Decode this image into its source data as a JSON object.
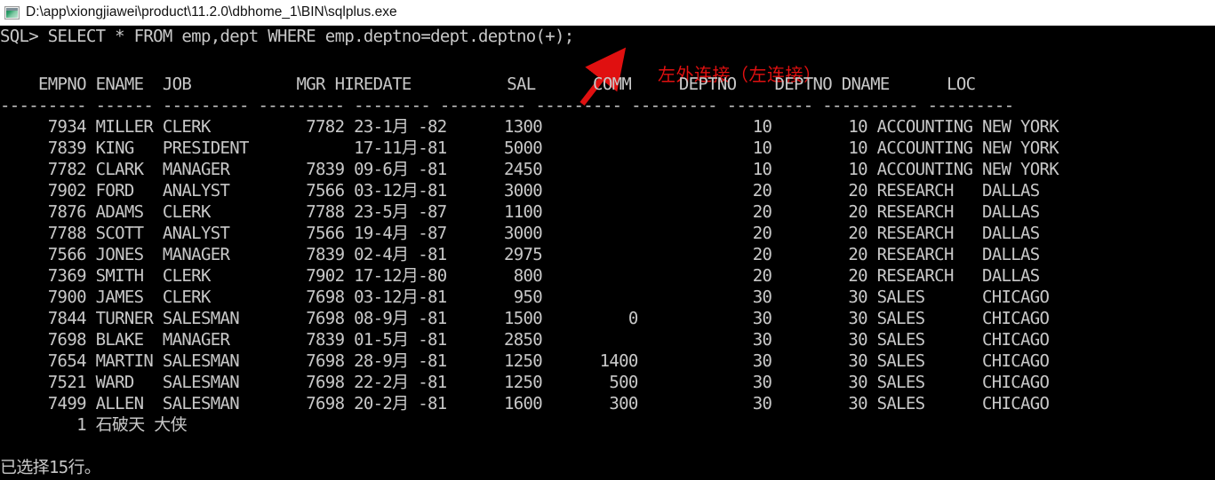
{
  "window": {
    "title": "D:\\app\\xiongjiawei\\product\\11.2.0\\dbhome_1\\BIN\\sqlplus.exe",
    "icon": "console-window-icon"
  },
  "terminal": {
    "prompt": "SQL>",
    "command": "SELECT * FROM emp,dept WHERE emp.deptno=dept.deptno(+);",
    "prompt_line": "SQL> SELECT * FROM emp,dept WHERE emp.deptno=dept.deptno(+);",
    "annotation": {
      "text": "左外连接（左连接）",
      "color": "#e01010",
      "arrow": "red-arrow-icon"
    },
    "header_line": "    EMPNO ENAME  JOB           MGR HIREDATE          SAL      COMM     DEPTNO    DEPTNO DNAME      LOC",
    "separator_line": "--------- ------ --------- --------- -------- --------- --------- --------- --------- ---------- ---------",
    "columns": [
      "EMPNO",
      "ENAME",
      "JOB",
      "MGR",
      "HIREDATE",
      "SAL",
      "COMM",
      "DEPTNO",
      "DEPTNO",
      "DNAME",
      "LOC"
    ],
    "rows": [
      {
        "empno": "7934",
        "ename": "MILLER",
        "job": "CLERK",
        "mgr": "7782",
        "hiredate": "23-1月 -82",
        "sal": "1300",
        "comm": "",
        "deptno_e": "10",
        "deptno_d": "10",
        "dname": "ACCOUNTING",
        "loc": "NEW YORK"
      },
      {
        "empno": "7839",
        "ename": "KING",
        "job": "PRESIDENT",
        "mgr": "",
        "hiredate": "17-11月-81",
        "sal": "5000",
        "comm": "",
        "deptno_e": "10",
        "deptno_d": "10",
        "dname": "ACCOUNTING",
        "loc": "NEW YORK"
      },
      {
        "empno": "7782",
        "ename": "CLARK",
        "job": "MANAGER",
        "mgr": "7839",
        "hiredate": "09-6月 -81",
        "sal": "2450",
        "comm": "",
        "deptno_e": "10",
        "deptno_d": "10",
        "dname": "ACCOUNTING",
        "loc": "NEW YORK"
      },
      {
        "empno": "7902",
        "ename": "FORD",
        "job": "ANALYST",
        "mgr": "7566",
        "hiredate": "03-12月-81",
        "sal": "3000",
        "comm": "",
        "deptno_e": "20",
        "deptno_d": "20",
        "dname": "RESEARCH",
        "loc": "DALLAS"
      },
      {
        "empno": "7876",
        "ename": "ADAMS",
        "job": "CLERK",
        "mgr": "7788",
        "hiredate": "23-5月 -87",
        "sal": "1100",
        "comm": "",
        "deptno_e": "20",
        "deptno_d": "20",
        "dname": "RESEARCH",
        "loc": "DALLAS"
      },
      {
        "empno": "7788",
        "ename": "SCOTT",
        "job": "ANALYST",
        "mgr": "7566",
        "hiredate": "19-4月 -87",
        "sal": "3000",
        "comm": "",
        "deptno_e": "20",
        "deptno_d": "20",
        "dname": "RESEARCH",
        "loc": "DALLAS"
      },
      {
        "empno": "7566",
        "ename": "JONES",
        "job": "MANAGER",
        "mgr": "7839",
        "hiredate": "02-4月 -81",
        "sal": "2975",
        "comm": "",
        "deptno_e": "20",
        "deptno_d": "20",
        "dname": "RESEARCH",
        "loc": "DALLAS"
      },
      {
        "empno": "7369",
        "ename": "SMITH",
        "job": "CLERK",
        "mgr": "7902",
        "hiredate": "17-12月-80",
        "sal": "800",
        "comm": "",
        "deptno_e": "20",
        "deptno_d": "20",
        "dname": "RESEARCH",
        "loc": "DALLAS"
      },
      {
        "empno": "7900",
        "ename": "JAMES",
        "job": "CLERK",
        "mgr": "7698",
        "hiredate": "03-12月-81",
        "sal": "950",
        "comm": "",
        "deptno_e": "30",
        "deptno_d": "30",
        "dname": "SALES",
        "loc": "CHICAGO"
      },
      {
        "empno": "7844",
        "ename": "TURNER",
        "job": "SALESMAN",
        "mgr": "7698",
        "hiredate": "08-9月 -81",
        "sal": "1500",
        "comm": "0",
        "deptno_e": "30",
        "deptno_d": "30",
        "dname": "SALES",
        "loc": "CHICAGO"
      },
      {
        "empno": "7698",
        "ename": "BLAKE",
        "job": "MANAGER",
        "mgr": "7839",
        "hiredate": "01-5月 -81",
        "sal": "2850",
        "comm": "",
        "deptno_e": "30",
        "deptno_d": "30",
        "dname": "SALES",
        "loc": "CHICAGO"
      },
      {
        "empno": "7654",
        "ename": "MARTIN",
        "job": "SALESMAN",
        "mgr": "7698",
        "hiredate": "28-9月 -81",
        "sal": "1250",
        "comm": "1400",
        "deptno_e": "30",
        "deptno_d": "30",
        "dname": "SALES",
        "loc": "CHICAGO"
      },
      {
        "empno": "7521",
        "ename": "WARD",
        "job": "SALESMAN",
        "mgr": "7698",
        "hiredate": "22-2月 -81",
        "sal": "1250",
        "comm": "500",
        "deptno_e": "30",
        "deptno_d": "30",
        "dname": "SALES",
        "loc": "CHICAGO"
      },
      {
        "empno": "7499",
        "ename": "ALLEN",
        "job": "SALESMAN",
        "mgr": "7698",
        "hiredate": "20-2月 -81",
        "sal": "1600",
        "comm": "300",
        "deptno_e": "30",
        "deptno_d": "30",
        "dname": "SALES",
        "loc": "CHICAGO"
      },
      {
        "empno": "1",
        "ename": "石破天",
        "job": "大侠",
        "mgr": "",
        "hiredate": "",
        "sal": "",
        "comm": "",
        "deptno_e": "",
        "deptno_d": "",
        "dname": "",
        "loc": ""
      }
    ],
    "row_lines": [
      "     7934 MILLER CLERK          7782 23-1月 -82      1300                      10        10 ACCOUNTING NEW YORK",
      "     7839 KING   PRESIDENT           17-11月-81      5000                      10        10 ACCOUNTING NEW YORK",
      "     7782 CLARK  MANAGER        7839 09-6月 -81      2450                      10        10 ACCOUNTING NEW YORK",
      "     7902 FORD   ANALYST        7566 03-12月-81      3000                      20        20 RESEARCH   DALLAS",
      "     7876 ADAMS  CLERK          7788 23-5月 -87      1100                      20        20 RESEARCH   DALLAS",
      "     7788 SCOTT  ANALYST        7566 19-4月 -87      3000                      20        20 RESEARCH   DALLAS",
      "     7566 JONES  MANAGER        7839 02-4月 -81      2975                      20        20 RESEARCH   DALLAS",
      "     7369 SMITH  CLERK          7902 17-12月-80       800                      20        20 RESEARCH   DALLAS",
      "     7900 JAMES  CLERK          7698 03-12月-81       950                      30        30 SALES      CHICAGO",
      "     7844 TURNER SALESMAN       7698 08-9月 -81      1500         0            30        30 SALES      CHICAGO",
      "     7698 BLAKE  MANAGER        7839 01-5月 -81      2850                      30        30 SALES      CHICAGO",
      "     7654 MARTIN SALESMAN       7698 28-9月 -81      1250      1400            30        30 SALES      CHICAGO",
      "     7521 WARD   SALESMAN       7698 22-2月 -81      1250       500            30        30 SALES      CHICAGO",
      "     7499 ALLEN  SALESMAN       7698 20-2月 -81      1600       300            30        30 SALES      CHICAGO",
      "        1 石破天 大侠"
    ],
    "footer": "已选择15行。",
    "row_count": 15,
    "text_color": "#c8c8c8",
    "background_color": "#000000"
  }
}
